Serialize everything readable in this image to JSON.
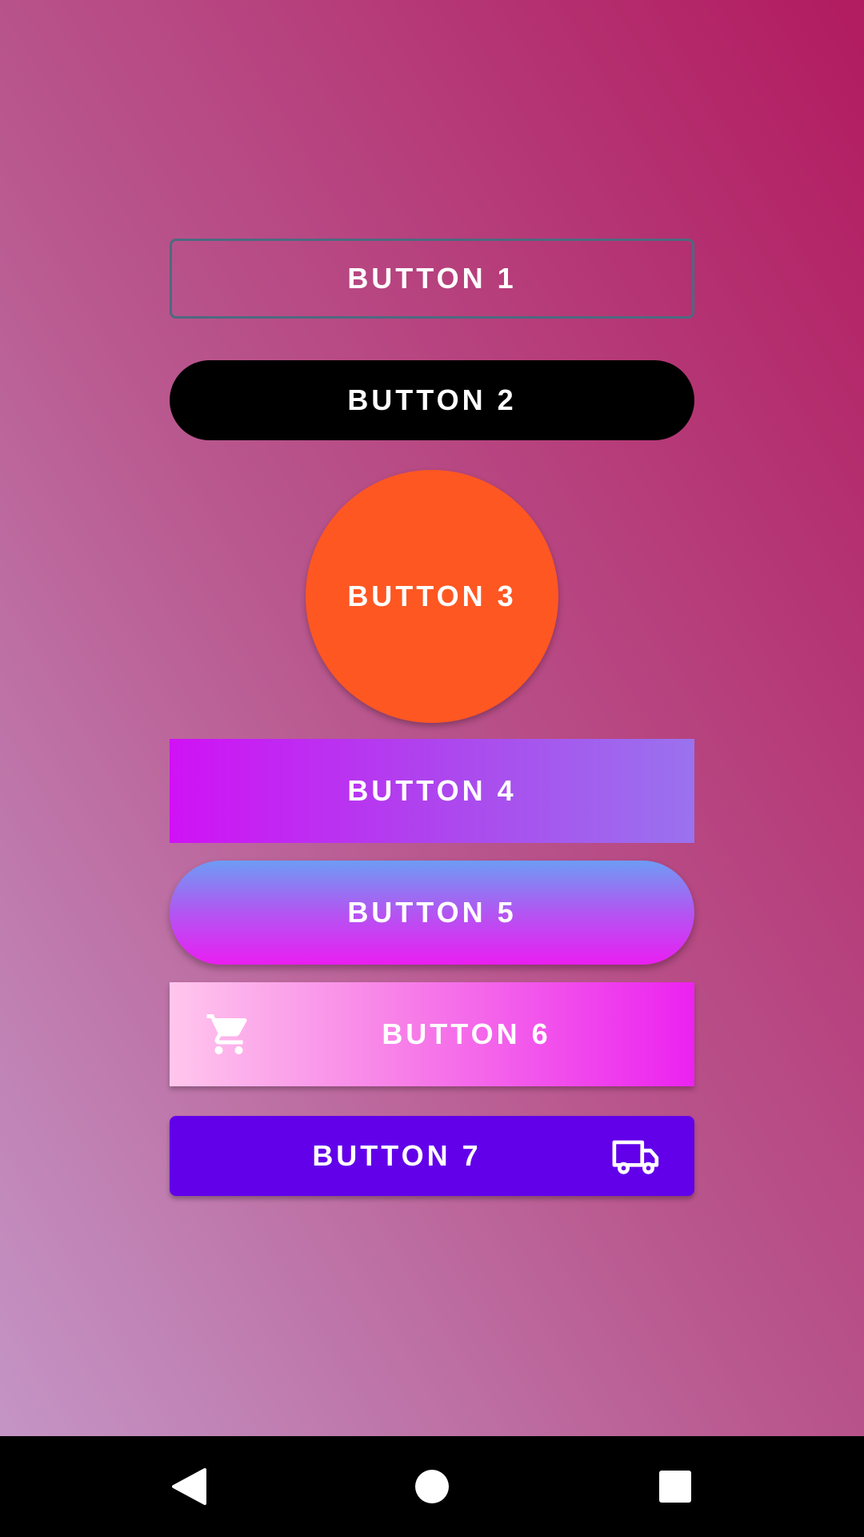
{
  "buttons": {
    "button_1": {
      "label": "BUTTON 1"
    },
    "button_2": {
      "label": "BUTTON 2"
    },
    "button_3": {
      "label": "BUTTON 3"
    },
    "button_4": {
      "label": "BUTTON 4"
    },
    "button_5": {
      "label": "BUTTON 5"
    },
    "button_6": {
      "label": "BUTTON 6",
      "icon": "shopping-cart-icon"
    },
    "button_7": {
      "label": "BUTTON 7",
      "icon": "truck-icon"
    }
  },
  "navigation_bar": {
    "back": {
      "icon": "back-triangle-icon"
    },
    "home": {
      "icon": "home-circle-icon"
    },
    "recents": {
      "icon": "recents-square-icon"
    }
  },
  "colors": {
    "background_gradient": [
      "#c495c5",
      "#b9588f",
      "#b21b60"
    ],
    "button_1_border": "#4d6a80",
    "button_2_fill": "#000000",
    "button_3_fill": "#ff5722",
    "button_4_gradient": [
      "#d012f5",
      "#9a72ee"
    ],
    "button_5_gradient": [
      "#6d9cf4",
      "#ea1ef2"
    ],
    "button_6_gradient": [
      "#ffc6ec",
      "#ec22f0"
    ],
    "button_7_fill": "#6200ea",
    "label_text": "#ffffff",
    "navigation_bar": "#000000"
  }
}
